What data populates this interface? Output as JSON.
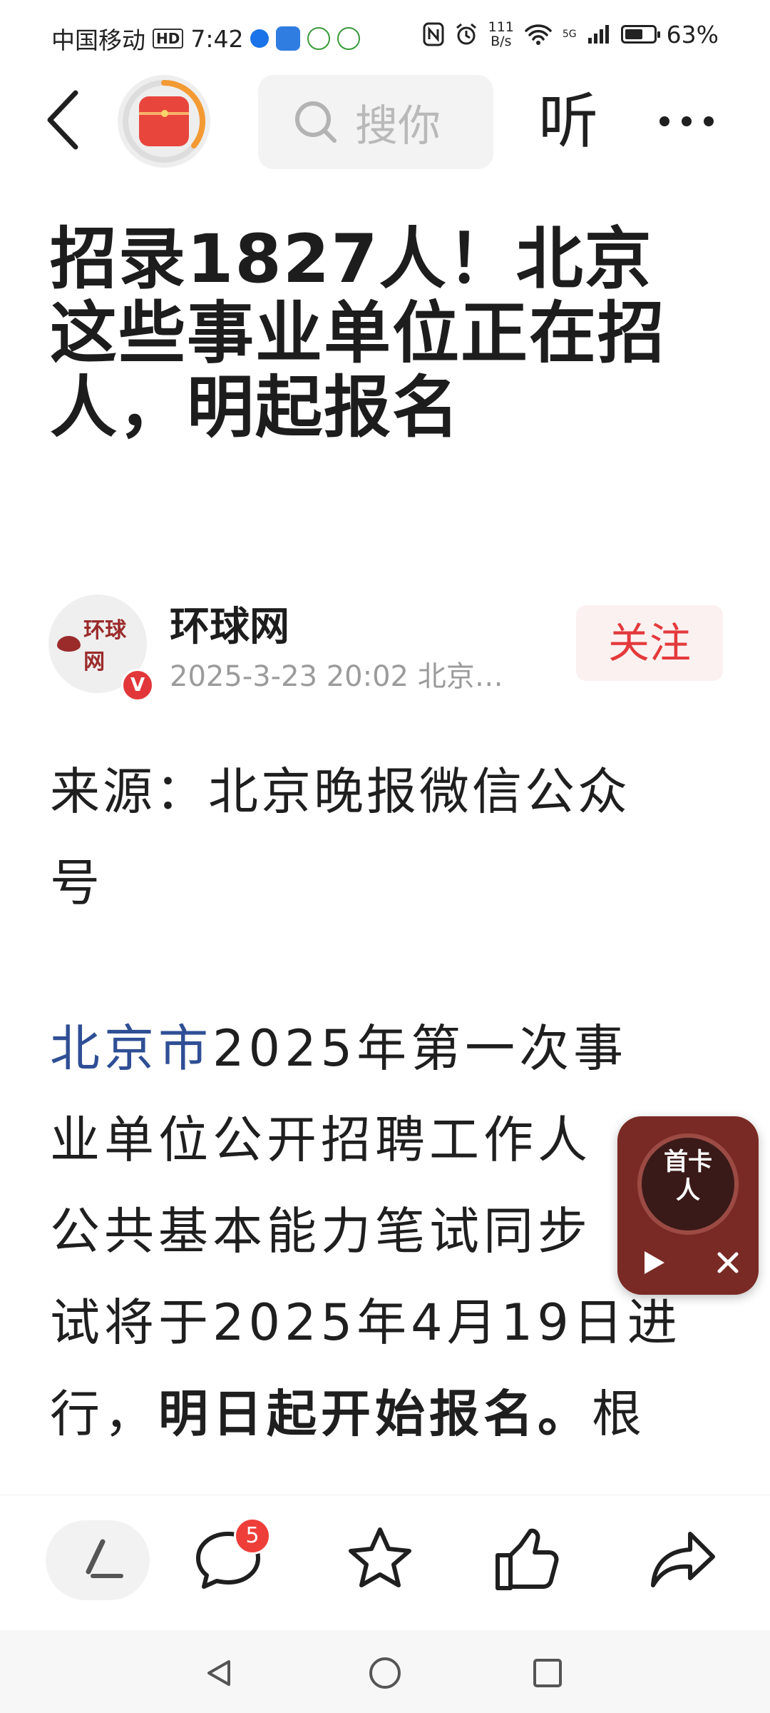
{
  "status_bar": {
    "carrier": "中国移动",
    "hd": "HD",
    "time": "7:42",
    "net_speed_value": "111",
    "net_speed_unit": "B/s",
    "signal_label": "5G",
    "battery_percent": "63%",
    "battery_level": 0.63
  },
  "nav": {
    "search_placeholder": "搜你",
    "listen_label": "听"
  },
  "article": {
    "title_lines": [
      "招录1827人！北京",
      "这些事业单位正在招",
      "人，明起报名"
    ],
    "author": {
      "name": "环球网",
      "meta": "2025-3-23  20:02  北京…",
      "avatar_text": "环球网",
      "verified": "V",
      "follow_label": "关注"
    },
    "source_line1": "来源：北京晚报微信公众",
    "source_line2": "号",
    "para_link": "北京市",
    "para_line1_rest": "2025年第一次事",
    "para_line2": "业单位公开招聘工作人",
    "para_line3": "公共基本能力笔试同步",
    "para_line4": "试将于2025年4月19日进",
    "para_line5_a": "行，",
    "para_line5_bold": "明日起开始报名。",
    "para_line5_b": "根"
  },
  "floating_player": {
    "cover_text_line1": "首卡",
    "cover_text_line2": "人"
  },
  "action_bar": {
    "comment_count": "5"
  },
  "colors": {
    "accent_red": "#e4393c",
    "link_blue": "#2f4f95",
    "player_bg": "#7a2a24"
  }
}
